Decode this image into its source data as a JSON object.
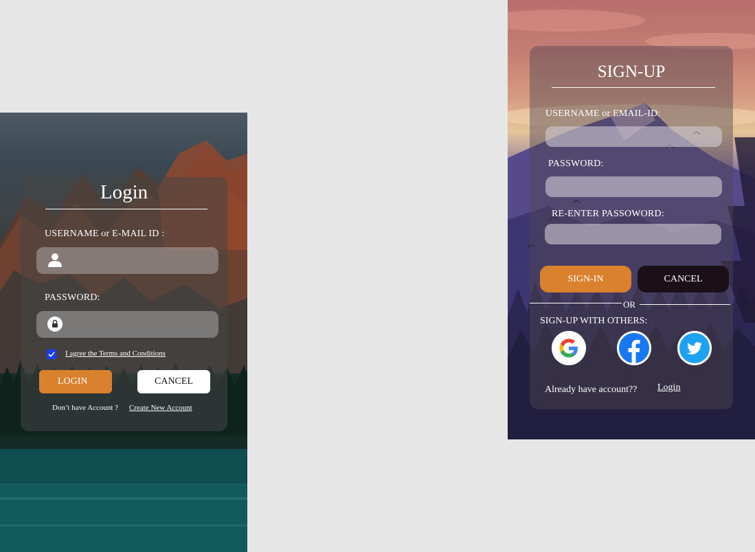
{
  "colors": {
    "page_bg": "#e6e6e6",
    "accent_orange": "#d9812d",
    "checkbox_blue": "#1a3cff",
    "dark_button": "#1c1018",
    "google_blue": "#4285F4",
    "google_red": "#EA4335",
    "google_yellow": "#FBBC05",
    "google_green": "#34A853",
    "facebook_blue": "#1877F2",
    "twitter_blue": "#1DA1F2"
  },
  "login": {
    "title": "Login",
    "username_label": "USERNAME or E-MAIL ID :",
    "username_value": "",
    "username_icon": "user-icon",
    "password_label": "PASSWORD:",
    "password_value": "",
    "password_icon": "lock-icon",
    "terms_checked": true,
    "terms_text": "I agree the Terms and Conditions",
    "login_button": "LOGIN",
    "cancel_button": "CANCEL",
    "no_account_text": "Don’t have Account ?",
    "create_account_link": "Create New Account"
  },
  "signup": {
    "title": "SIGN-UP",
    "username_label": "USERNAME or EMAIL-ID:",
    "username_value": "",
    "password_label": "PASSWORD:",
    "password_value": "",
    "reenter_label": "RE-ENTER PASSOWORD:",
    "reenter_value": "",
    "signin_button": "SIGN-IN",
    "cancel_button": "CANCEL",
    "or_text": "OR",
    "others_label": "SIGN-UP WITH OTHERS:",
    "social": [
      "google-icon",
      "facebook-icon",
      "twitter-icon"
    ],
    "already_text": "Already have account??",
    "login_link": "Login"
  }
}
